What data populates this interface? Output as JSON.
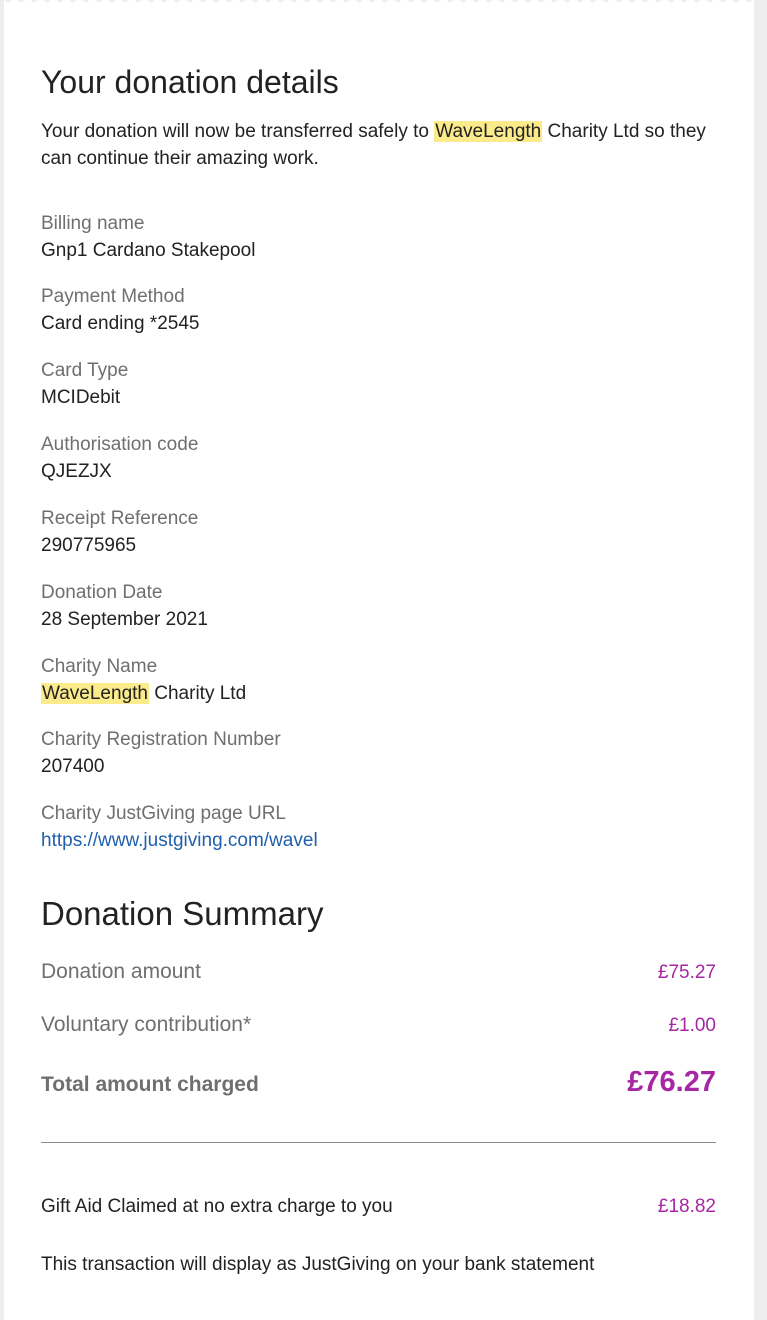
{
  "details": {
    "title": "Your donation details",
    "intro_before": "Your donation will now be transferred safely to ",
    "intro_highlight": "WaveLength",
    "intro_after": " Charity Ltd so they can continue their amazing work.",
    "billing_name": {
      "label": "Billing name",
      "value": "Gnp1 Cardano Stakepool"
    },
    "payment_method": {
      "label": "Payment Method",
      "value": "Card ending *2545"
    },
    "card_type": {
      "label": "Card Type",
      "value": "MCIDebit"
    },
    "authorisation_code": {
      "label": "Authorisation code",
      "value": "QJEZJX"
    },
    "receipt_reference": {
      "label": "Receipt Reference",
      "value": "290775965"
    },
    "donation_date": {
      "label": "Donation Date",
      "value": "28 September 2021"
    },
    "charity_name": {
      "label": "Charity Name",
      "value_highlight": "WaveLength",
      "value_rest": " Charity Ltd"
    },
    "charity_registration": {
      "label": "Charity Registration Number",
      "value": "207400"
    },
    "charity_url": {
      "label": "Charity JustGiving page URL",
      "value": "https://www.justgiving.com/wavel"
    }
  },
  "summary": {
    "title": "Donation Summary",
    "donation_amount": {
      "label": "Donation amount",
      "value": "£75.27"
    },
    "voluntary_contribution": {
      "label": "Voluntary contribution*",
      "value": "£1.00"
    },
    "total": {
      "label": "Total amount charged",
      "value": "£76.27"
    },
    "gift_aid": {
      "label": "Gift Aid Claimed at no extra charge to you",
      "value": "£18.82"
    },
    "statement_note": "This transaction will display as JustGiving on your bank statement"
  },
  "colors": {
    "highlight": "#fbeb8a",
    "amount": "#a626a4",
    "link": "#1f5fad",
    "label_grey": "#6f6f6f",
    "text": "#222222",
    "page_bg": "#ededed"
  }
}
